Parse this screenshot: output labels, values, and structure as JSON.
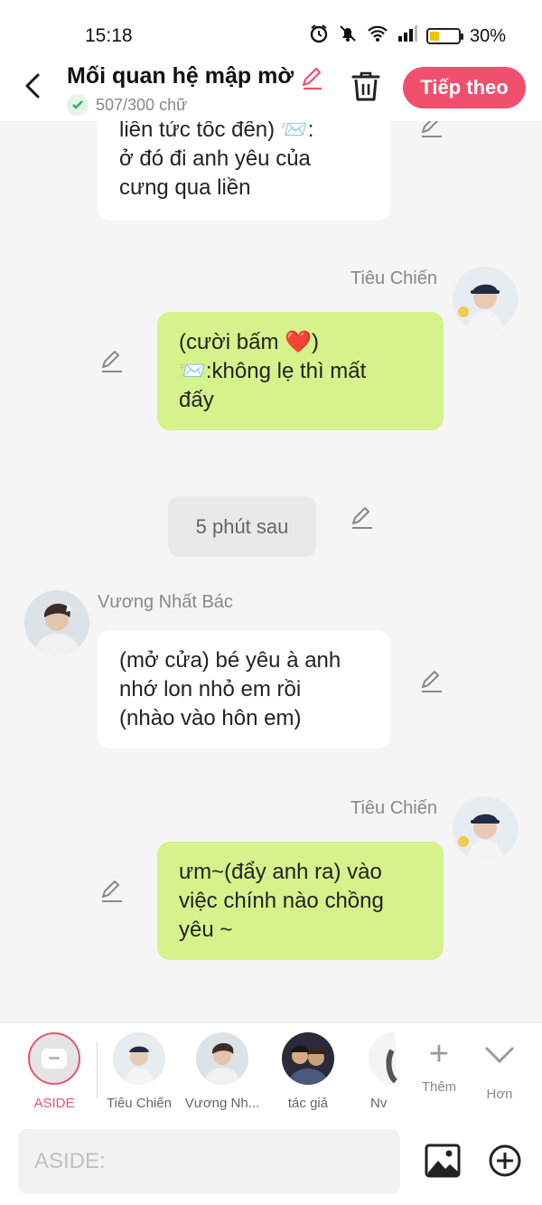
{
  "status_bar": {
    "time": "15:18",
    "battery": "30%",
    "battery_fraction": 0.3,
    "icons": [
      "alarm-icon",
      "mute-icon",
      "wifi-icon",
      "signal-icon",
      "battery-icon"
    ]
  },
  "header": {
    "title": "Mối quan hệ mập mờ",
    "word_count": "507/300 chữ",
    "next_label": "Tiếp theo"
  },
  "messages": [
    {
      "side": "left",
      "text": "liền tức tốc đến) 📨:\nở đó đi anh yêu của\ncưng qua liền"
    },
    {
      "side": "right",
      "name": "Tiêu Chiến",
      "text": "(cười bấm ❤️)\n📨:không lẹ thì mất\nđấy"
    },
    {
      "type": "timeline",
      "text": "5 phút sau"
    },
    {
      "side": "left",
      "name": "Vương Nhất Bác",
      "text": "(mở cửa) bé yêu à anh\nnhớ lon nhỏ em rồi\n(nhào vào hôn em)"
    },
    {
      "side": "right",
      "name": "Tiêu Chiến",
      "text": "ưm~(đẩy anh ra) vào\nviệc chính nào chồng\nyêu ~"
    }
  ],
  "characters": {
    "aside": "ASIDE",
    "list": [
      "Tiêu Chiến",
      "Vương Nh...",
      "tác giả",
      "Nv"
    ],
    "more_label": "Thêm",
    "expand_label": "Hơn"
  },
  "input": {
    "placeholder": "ASIDE:"
  },
  "colors": {
    "accent": "#f0506e",
    "green_bubble": "#d6f28a",
    "white_bubble": "#ffffff",
    "background": "#f5f5f5"
  }
}
